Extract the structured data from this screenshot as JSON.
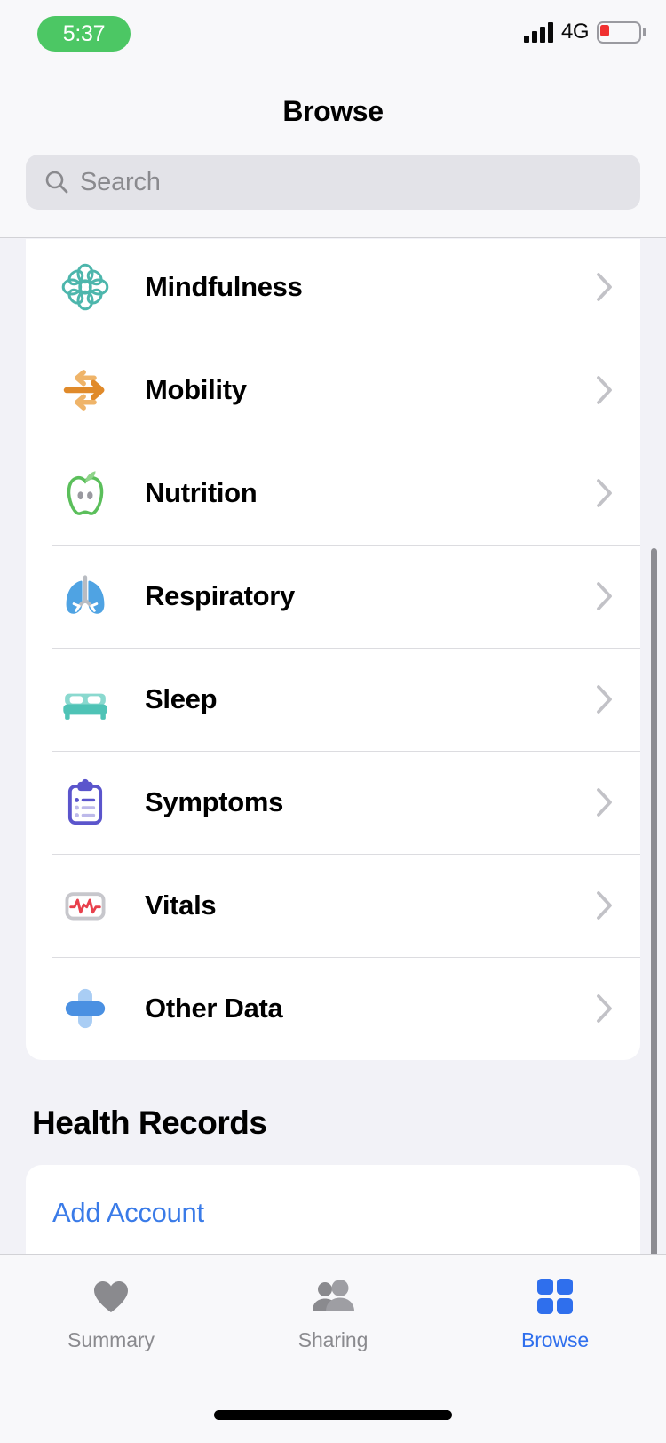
{
  "status_bar": {
    "time": "5:37",
    "network_type": "4G",
    "signal_icon": "cellular-signal-icon",
    "battery_icon": "battery-low-icon",
    "battery_level_percent": 20,
    "time_pill_color": "#4CC764",
    "battery_fill_color": "#F03030"
  },
  "header": {
    "title": "Browse"
  },
  "search": {
    "placeholder": "Search",
    "value": "",
    "icon": "search-icon"
  },
  "categories": {
    "items": [
      {
        "label": "Mindfulness",
        "icon": "mindfulness-brain-icon",
        "color": "#4DB6AC",
        "chevron": "chevron-right-icon"
      },
      {
        "label": "Mobility",
        "icon": "mobility-arrows-icon",
        "color": "#E59A3C",
        "chevron": "chevron-right-icon"
      },
      {
        "label": "Nutrition",
        "icon": "nutrition-apple-icon",
        "color": "#5BBF5B",
        "chevron": "chevron-right-icon"
      },
      {
        "label": "Respiratory",
        "icon": "respiratory-lungs-icon",
        "color": "#53A8E8",
        "chevron": "chevron-right-icon"
      },
      {
        "label": "Sleep",
        "icon": "sleep-bed-icon",
        "color": "#4FC3B6",
        "chevron": "chevron-right-icon"
      },
      {
        "label": "Symptoms",
        "icon": "symptoms-clipboard-icon",
        "color": "#5B55CC",
        "chevron": "chevron-right-icon"
      },
      {
        "label": "Vitals",
        "icon": "vitals-monitor-icon",
        "color": "#E8404C",
        "chevron": "chevron-right-icon"
      },
      {
        "label": "Other Data",
        "icon": "other-data-cross-icon",
        "color": "#4A90E2",
        "chevron": "chevron-right-icon"
      }
    ]
  },
  "health_records": {
    "section_title": "Health Records",
    "add_account_label": "Add Account",
    "link_color": "#3A7BE8"
  },
  "tab_bar": {
    "accent_color": "#2F6FED",
    "inactive_color": "#8A8A8E",
    "tabs": [
      {
        "label": "Summary",
        "icon": "heart-icon",
        "active": false
      },
      {
        "label": "Sharing",
        "icon": "people-icon",
        "active": false
      },
      {
        "label": "Browse",
        "icon": "grid-icon",
        "active": true
      }
    ]
  }
}
